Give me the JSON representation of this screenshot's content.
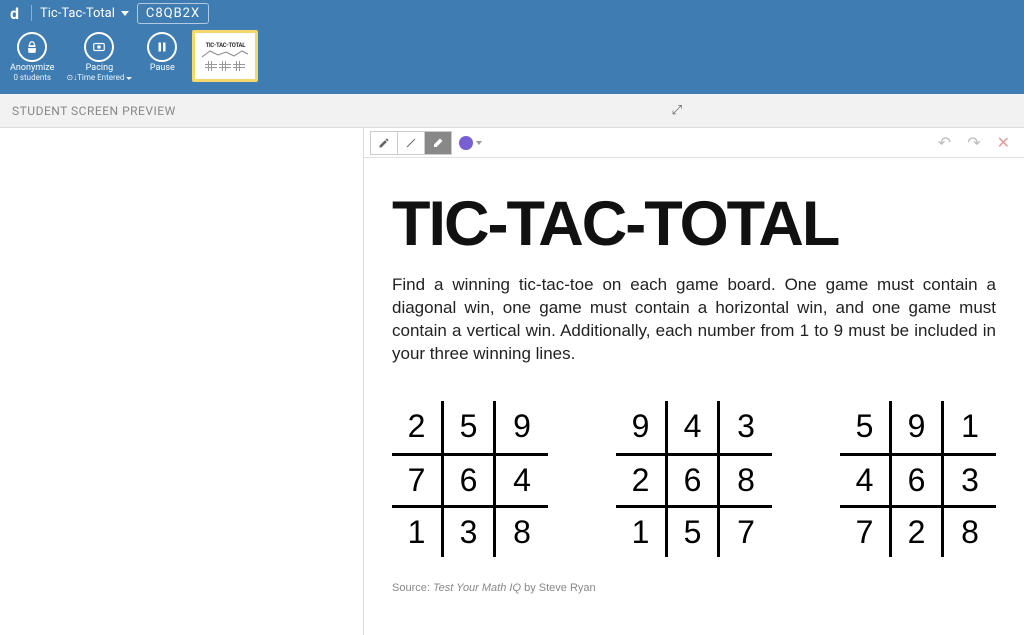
{
  "header": {
    "logo": "d",
    "title": "Tic-Tac-Total",
    "code": "C8QB2X"
  },
  "tools": {
    "anonymize": {
      "label": "Anonymize",
      "sublabel": "0 students"
    },
    "pacing": {
      "label": "Pacing",
      "sublabel": "⊙↓Time Entered"
    },
    "pause": {
      "label": "Pause",
      "sublabel": ""
    },
    "thumb_title": "TIC-TAC-TOTAL"
  },
  "preview": {
    "label": "STUDENT SCREEN PREVIEW"
  },
  "draw_tools": {
    "pencil": "pencil",
    "line": "line",
    "eraser": "eraser",
    "color": "#7a5fd4"
  },
  "slide": {
    "title": "TIC-TAC-TOTAL",
    "description": "Find a winning tic-tac-toe on each game board. One game must contain a diagonal win, one game must contain a horizontal win, and one game must contain a vertical win. Additionally, each number from 1 to 9 must be included in your three winning lines.",
    "boards": [
      [
        "2",
        "5",
        "9",
        "7",
        "6",
        "4",
        "1",
        "3",
        "8"
      ],
      [
        "9",
        "4",
        "3",
        "2",
        "6",
        "8",
        "1",
        "5",
        "7"
      ],
      [
        "5",
        "9",
        "1",
        "4",
        "6",
        "3",
        "7",
        "2",
        "8"
      ]
    ],
    "source_prefix": "Source: ",
    "source_title": "Test Your Math IQ",
    "source_suffix": " by Steve Ryan"
  }
}
